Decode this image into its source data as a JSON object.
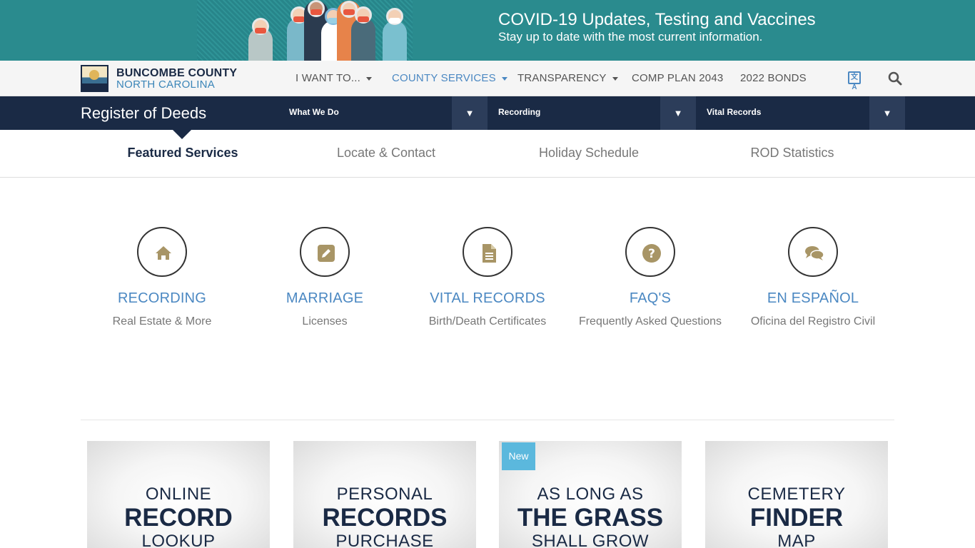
{
  "covid_banner": {
    "title": "COVID-19 Updates, Testing and Vaccines",
    "subtitle": "Stay up to date with the most current information."
  },
  "brand": {
    "line1": "BUNCOMBE COUNTY",
    "line2": "NORTH CAROLINA"
  },
  "main_nav": {
    "items": [
      {
        "label": "I WANT TO...",
        "dropdown": true
      },
      {
        "label": "COUNTY SERVICES",
        "dropdown": true
      },
      {
        "label": "TRANSPARENCY",
        "dropdown": true
      },
      {
        "label": "COMP PLAN 2043",
        "dropdown": false
      },
      {
        "label": "2022 BONDS",
        "dropdown": false
      }
    ],
    "translate_glyph": "文A",
    "icons": [
      "translate-icon",
      "search-icon"
    ]
  },
  "dept": {
    "title": "Register of Deeds",
    "dropdowns": [
      {
        "label": "What We Do",
        "arrow": "▼"
      },
      {
        "label": "Recording",
        "arrow": "▼"
      },
      {
        "label": "Vital Records",
        "arrow": "▼"
      }
    ]
  },
  "tabs": [
    {
      "label": "Featured Services",
      "active": true
    },
    {
      "label": "Locate & Contact",
      "active": false
    },
    {
      "label": "Holiday Schedule",
      "active": false
    },
    {
      "label": "ROD Statistics",
      "active": false
    }
  ],
  "services": [
    {
      "name": "RECORDING",
      "desc": "Real Estate & More",
      "icon": "home-icon"
    },
    {
      "name": "MARRIAGE",
      "desc": "Licenses",
      "icon": "edit-icon"
    },
    {
      "name": "VITAL RECORDS",
      "desc": "Birth/Death Certificates",
      "icon": "document-icon"
    },
    {
      "name": "FAQ'S",
      "desc": "Frequently Asked Questions",
      "icon": "question-icon"
    },
    {
      "name": "EN ESPAÑOL",
      "desc": "Oficina del Registro Civil",
      "icon": "chat-icon"
    }
  ],
  "cards": [
    {
      "line1": "ONLINE",
      "line2": "RECORD",
      "line3": "LOOKUP"
    },
    {
      "line1": "PERSONAL",
      "line2": "RECORDS",
      "line3": "PURCHASE"
    },
    {
      "line1": "AS LONG AS",
      "line2": "THE GRASS",
      "line3": "SHALL GROW",
      "badge": "New"
    },
    {
      "line1": "CEMETERY",
      "line2": "FINDER",
      "line3": "MAP"
    }
  ],
  "colors": {
    "banner": "#2a8b8e",
    "navy": "#1a2a45",
    "accent_blue": "#4b88c2",
    "icon_gold": "#a89566",
    "badge": "#5bb8dd"
  }
}
